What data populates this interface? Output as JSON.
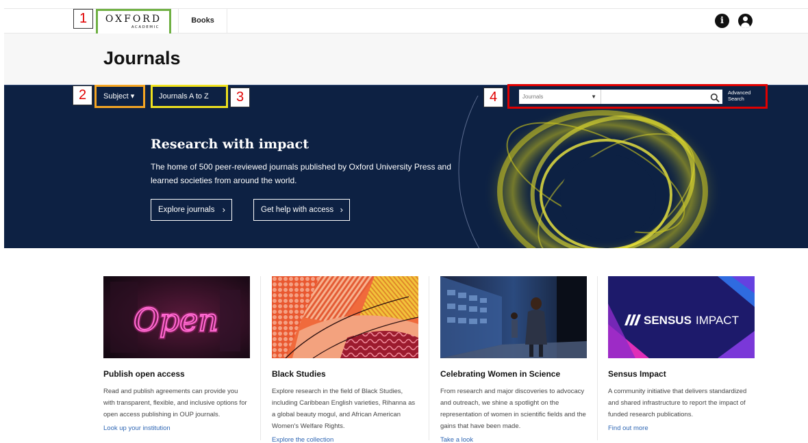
{
  "header": {
    "logo_line1": "OXFORD",
    "logo_line2": "ACADEMIC",
    "books_label": "Books",
    "info_icon": "info-icon",
    "user_icon": "user-icon"
  },
  "annotations": [
    "1",
    "2",
    "3",
    "4"
  ],
  "page_title": "Journals",
  "nav": {
    "subject_label": "Subject ▾",
    "journals_az_label": "Journals A to Z"
  },
  "search": {
    "scope_value": "Journals",
    "input_value": "",
    "advanced_label_line1": "Advanced",
    "advanced_label_line2": "Search"
  },
  "hero": {
    "heading": "Research with impact",
    "text": "The home of 500 peer-reviewed journals published by Oxford University Press and learned societies from around the world.",
    "explore_label": "Explore journals",
    "help_label": "Get help with access"
  },
  "cards": [
    {
      "title": "Publish open access",
      "text": "Read and publish agreements can provide you with transparent, flexible, and inclusive options for open access publishing in OUP journals.",
      "link": "Look up your institution",
      "image_text": "Open"
    },
    {
      "title": "Black Studies",
      "text": "Explore research in the field of Black Studies, including Caribbean English varieties, Rihanna as a global beauty mogul, and African American Women's Welfare Rights.",
      "link": "Explore the collection"
    },
    {
      "title": "Celebrating Women in Science",
      "text": "From research and major discoveries to advocacy and outreach, we shine a spotlight on the representation of women in scientific fields and the gains that have been made.",
      "link": "Take a look"
    },
    {
      "title": "Sensus Impact",
      "text": "A community initiative that delivers standardized and shared infrastructure to report the impact of funded research publications.",
      "link": "Find out more",
      "image_text_bold": "SENSUS",
      "image_text_light": "IMPACT"
    }
  ],
  "colors": {
    "hero_bg": "#0d2143",
    "link": "#2d65b3",
    "annot_logo": "#6fb043",
    "annot_subject": "#f5a623",
    "annot_az": "#f0e21e",
    "annot_search": "#e00000"
  }
}
